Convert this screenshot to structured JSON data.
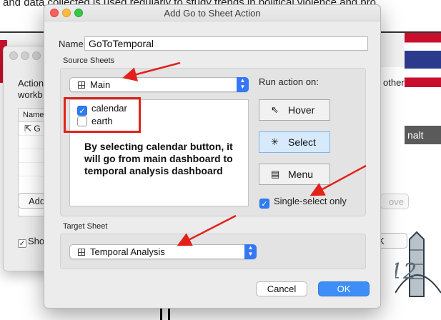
{
  "background": {
    "headline": "and data collected is used regularly to study trends in political violence and pro",
    "right_label": "other",
    "right_tab": "nalt",
    "right_button": "ove",
    "right_ok": "K",
    "deco_text": "12",
    "behind_window": {
      "action_label": "Action",
      "workbook_label": "workb",
      "column_header": "Name",
      "row_label": "G",
      "add_button": "Add",
      "show_checkbox": "Sho"
    }
  },
  "dialog": {
    "title": "Add Go to Sheet Action",
    "name_label": "Name:",
    "name_value": "GoToTemporal",
    "source_sheets_label": "Source Sheets",
    "source_dropdown": "Main",
    "sheets": [
      {
        "label": "calendar",
        "checked": true
      },
      {
        "label": "earth",
        "checked": false
      }
    ],
    "annotation": "By selecting calendar button, it will go from main dashboard to temporal analysis dashboard",
    "run_action_label": "Run action on:",
    "run_buttons": [
      {
        "label": "Hover",
        "icon": "pointer-icon",
        "selected": false
      },
      {
        "label": "Select",
        "icon": "select-cursor-icon",
        "selected": true
      },
      {
        "label": "Menu",
        "icon": "menu-icon",
        "selected": false
      }
    ],
    "single_select_label": "Single-select only",
    "single_select_checked": true,
    "target_sheet_label": "Target Sheet",
    "target_dropdown": "Temporal Analysis",
    "cancel_label": "Cancel",
    "ok_label": "OK"
  },
  "colors": {
    "accent": "#3478f6",
    "annotation_red": "#e3211b",
    "selected_button": "#d6eafc"
  }
}
